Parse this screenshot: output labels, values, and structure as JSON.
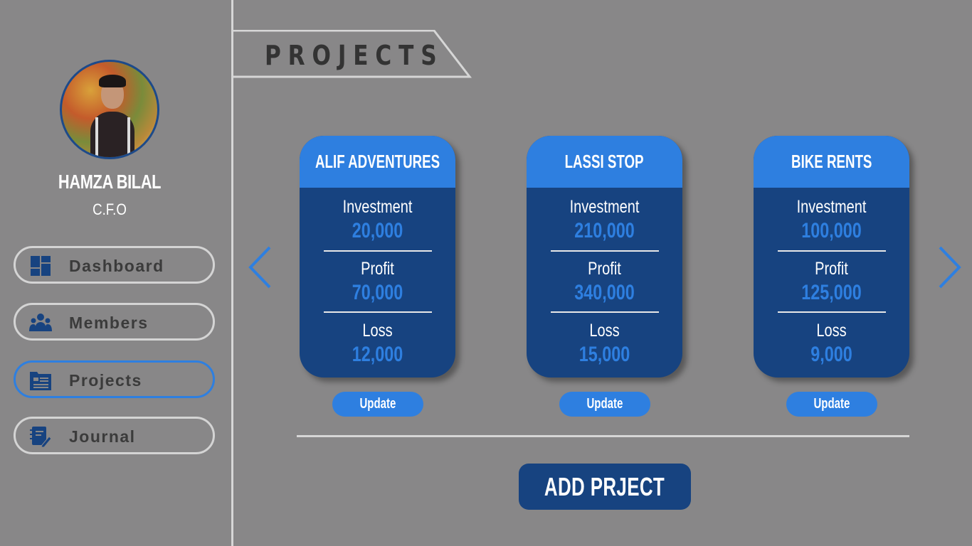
{
  "sidebar": {
    "user_name": "HAMZA BILAL",
    "user_role": "C.F.O",
    "items": [
      {
        "label": "Dashboard",
        "icon": "dashboard-icon",
        "active": false
      },
      {
        "label": "Members",
        "icon": "members-icon",
        "active": false
      },
      {
        "label": "Projects",
        "icon": "projects-icon",
        "active": true
      },
      {
        "label": "Journal",
        "icon": "journal-icon",
        "active": false
      }
    ]
  },
  "header": {
    "title": "PROJECTS"
  },
  "projects": [
    {
      "name": "ALIF ADVENTURES",
      "investment_label": "Investment",
      "investment": "20,000",
      "profit_label": "Profit",
      "profit": "70,000",
      "loss_label": "Loss",
      "loss": "12,000",
      "update_label": "Update"
    },
    {
      "name": "LASSI STOP",
      "investment_label": "Investment",
      "investment": "210,000",
      "profit_label": "Profit",
      "profit": "340,000",
      "loss_label": "Loss",
      "loss": "15,000",
      "update_label": "Update"
    },
    {
      "name": "BIKE RENTS",
      "investment_label": "Investment",
      "investment": "100,000",
      "profit_label": "Profit",
      "profit": "125,000",
      "loss_label": "Loss",
      "loss": "9,000",
      "update_label": "Update"
    }
  ],
  "add_project_label": "ADD PRJECT",
  "colors": {
    "accent": "#2e7fe0",
    "navy": "#174380",
    "background": "#888788"
  }
}
